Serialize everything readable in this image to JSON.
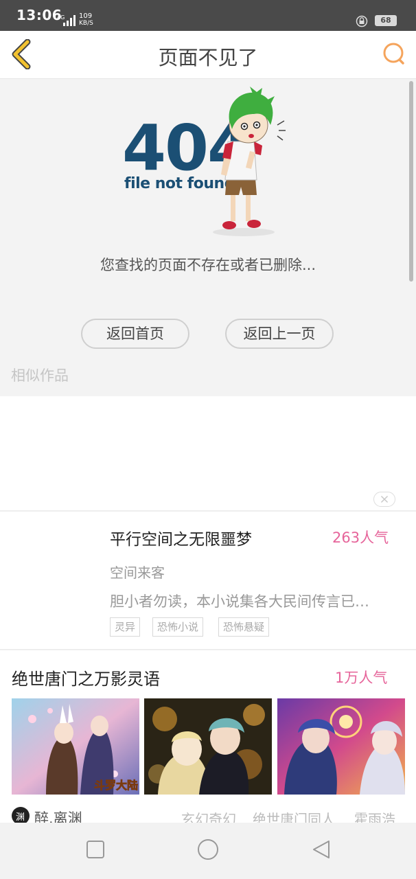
{
  "status_bar": {
    "time": "13:06",
    "network": "4G",
    "speed_value": "109",
    "speed_unit": "KB/S",
    "battery": "68"
  },
  "header": {
    "title": "页面不见了",
    "back_icon": "back-chevron-icon",
    "search_icon": "search-icon"
  },
  "error": {
    "code": "404",
    "code_caption": "file not found",
    "message": "您查找的页面不存在或者已删除...",
    "buttons": {
      "home": "返回首页",
      "previous": "返回上一页"
    }
  },
  "similar_works": {
    "label": "相似作品"
  },
  "book_card": {
    "title": "平行空间之无限噩梦",
    "popularity": "263人气",
    "author": "空间来客",
    "description": "胆小者勿读，本小说集各大民间传言已…",
    "tags": [
      "灵异",
      "恐怖小说",
      "恐怖悬疑"
    ]
  },
  "section2": {
    "title": "绝世唐门之万影灵语",
    "popularity": "1万人气",
    "cover_caption": "斗罗大陆",
    "author": "醉.离渊",
    "avatar_glyph": "渊",
    "tags": [
      "玄幻奇幻",
      "绝世唐门同人",
      "霍雨浩"
    ]
  },
  "colors": {
    "accent_pink": "#e6649a",
    "navy": "#1b4f74",
    "back_yellow": "#f2c230",
    "search_orange": "#f5a45c"
  }
}
